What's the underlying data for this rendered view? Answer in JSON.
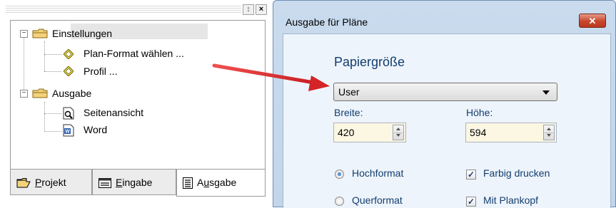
{
  "tree": {
    "items": [
      {
        "label": "Einstellungen",
        "icon": "folder-icon"
      },
      {
        "label": "Plan-Format wählen ...",
        "icon": "diamond-icon"
      },
      {
        "label": "Profil ...",
        "icon": "diamond-icon"
      },
      {
        "label": "Ausgabe",
        "icon": "folder-icon"
      },
      {
        "label": "Seitenansicht",
        "icon": "print-preview-icon"
      },
      {
        "label": "Word",
        "icon": "word-document-icon"
      }
    ],
    "expander_expanded": "−",
    "pin_glyph": "↕",
    "close_glyph": "×"
  },
  "tabs": [
    {
      "label_prefix": "",
      "underline": "P",
      "label_suffix": "rojekt",
      "icon": "folder-open-icon"
    },
    {
      "label_prefix": "",
      "underline": "E",
      "label_suffix": "ingabe",
      "icon": "input-form-icon"
    },
    {
      "label_prefix": "A",
      "underline": "u",
      "label_suffix": "sgabe",
      "icon": "output-document-icon"
    }
  ],
  "dialog": {
    "title": "Ausgabe für Pläne",
    "close_glyph": "✕",
    "section_title": "Papiergröße",
    "paper_select": {
      "value": "User"
    },
    "width": {
      "label": "Breite:",
      "value": "420"
    },
    "height": {
      "label": "Höhe:",
      "value": "594"
    },
    "orientation": [
      {
        "label": "Hochformat",
        "checked": true
      },
      {
        "label": "Querformat",
        "checked": false
      }
    ],
    "options": [
      {
        "label": "Farbig drucken",
        "checked": true
      },
      {
        "label": "Mit Plankopf",
        "checked": true
      }
    ],
    "check_glyph": "✓"
  },
  "colors": {
    "arrow": "#e0282c",
    "dialog_title_bar": "#c9dbed",
    "close_button": "#c8462c",
    "input_background": "#fbf7e2",
    "label_text": "#123d6e"
  }
}
